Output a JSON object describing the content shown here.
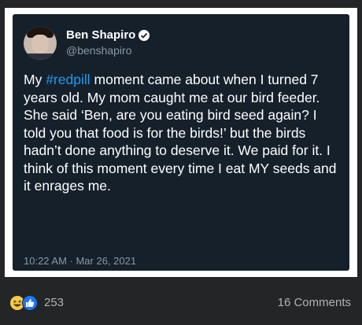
{
  "tweet": {
    "display_name": "Ben Shapiro",
    "handle": "@benshapiro",
    "text_before": "My ",
    "hashtag": "#redpill",
    "text_after": " moment came about when I turned 7 years old. My mom caught me at our bird feeder. She said ‘Ben, are you eating bird seed again? I told you that food is for the birds!’ but the birds hadn’t done anything to deserve it. We paid for it. I think of this moment every time I eat MY seeds and it enrages me.",
    "timestamp": "10:22 AM · Mar 26, 2021"
  },
  "post_footer": {
    "reaction_count": "253",
    "comments": "16 Comments"
  },
  "icons": {
    "reactions": [
      "haha-reaction-icon",
      "like-reaction-icon"
    ],
    "verified": "verified-badge-icon"
  },
  "colors": {
    "tweet_background": "#15202b",
    "hashtag": "#1d9bf0",
    "like_blue": "#1877f2",
    "page_background": "#242526"
  }
}
